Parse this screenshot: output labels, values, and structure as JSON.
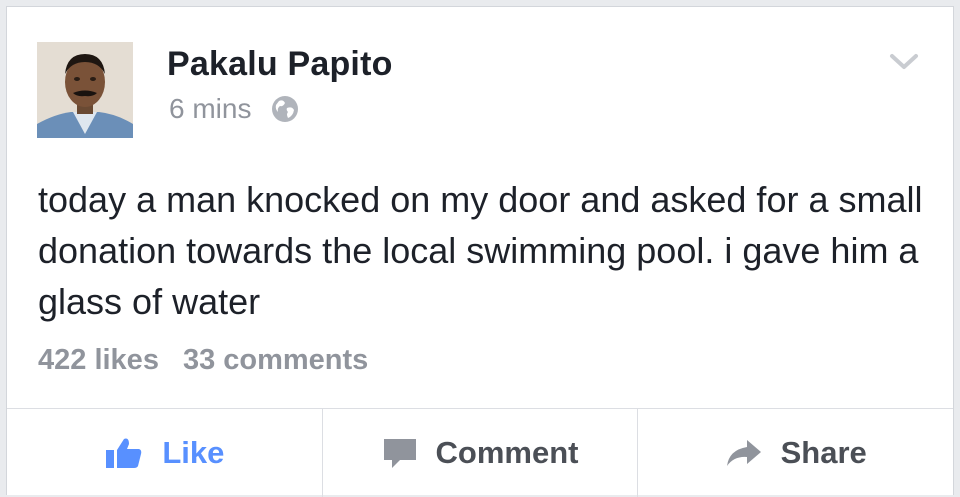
{
  "post": {
    "author": "Pakalu Papito",
    "time": "6 mins",
    "privacy_icon": "globe-icon",
    "text": "today a man knocked on my door and asked for a small donation towards the local swimming pool. i gave him a glass of water",
    "likes": "422 likes",
    "comments": "33 comments"
  },
  "actions": {
    "like_label": "Like",
    "comment_label": "Comment",
    "share_label": "Share"
  },
  "colors": {
    "like_accent": "#5890ff",
    "secondary_text": "#90949c",
    "primary_text": "#1d2129"
  }
}
